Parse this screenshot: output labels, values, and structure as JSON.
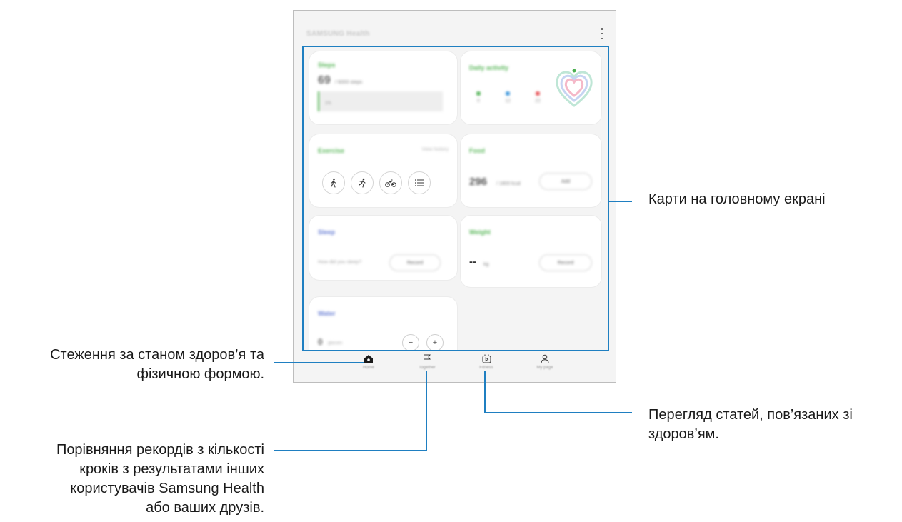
{
  "app": {
    "title": "SAMSUNG Health",
    "more_icon": "more-vertical-icon"
  },
  "cards": {
    "steps": {
      "title": "Steps",
      "value": "69",
      "goal": "/ 6000 steps",
      "percent": "1%",
      "progress": 0.01
    },
    "daily_activity": {
      "title": "Daily activity",
      "stats": [
        {
          "icon": "activity-time-icon",
          "color": "#4caf50",
          "value": "0"
        },
        {
          "icon": "active-minutes-icon",
          "color": "#2f8fd8",
          "value": "12"
        },
        {
          "icon": "calories-flame-icon",
          "color": "#e5484d",
          "value": "22"
        }
      ]
    },
    "exercise": {
      "title": "Exercise",
      "history_link": "View history",
      "buttons": [
        "walking-icon",
        "running-icon",
        "cycling-icon",
        "exercise-list-icon"
      ]
    },
    "food": {
      "title": "Food",
      "value": "296",
      "goal": "/ 1800 kcal",
      "button": "Add"
    },
    "sleep": {
      "title": "Sleep",
      "question": "How did you sleep?",
      "button": "Record"
    },
    "weight": {
      "title": "Weight",
      "value": "--",
      "unit": "kg",
      "button": "Record"
    },
    "water": {
      "title": "Water",
      "value": "0",
      "unit": "glasses",
      "minus": "−",
      "plus": "+"
    }
  },
  "nav": {
    "items": [
      {
        "label": "Home",
        "icon": "home-icon",
        "active": true
      },
      {
        "label": "Together",
        "icon": "flag-icon",
        "active": false
      },
      {
        "label": "Fitness",
        "icon": "fitness-video-icon",
        "active": false
      },
      {
        "label": "My page",
        "icon": "person-icon",
        "active": false
      }
    ]
  },
  "callouts": {
    "cards": "Карти на головному екрані",
    "home": [
      "Стеження за станом здоров’я та",
      "фізичною формою."
    ],
    "fitness": [
      "Перегляд статей, пов’язаних зі",
      "здоров’ям."
    ],
    "together": [
      "Порівняння рекордів з кількості",
      "кроків з результатами інших",
      "користувачів Samsung Health",
      "або ваших друзів."
    ]
  },
  "colors": {
    "accent": "#1f7fc1",
    "brand_green": "#5cb85c"
  }
}
